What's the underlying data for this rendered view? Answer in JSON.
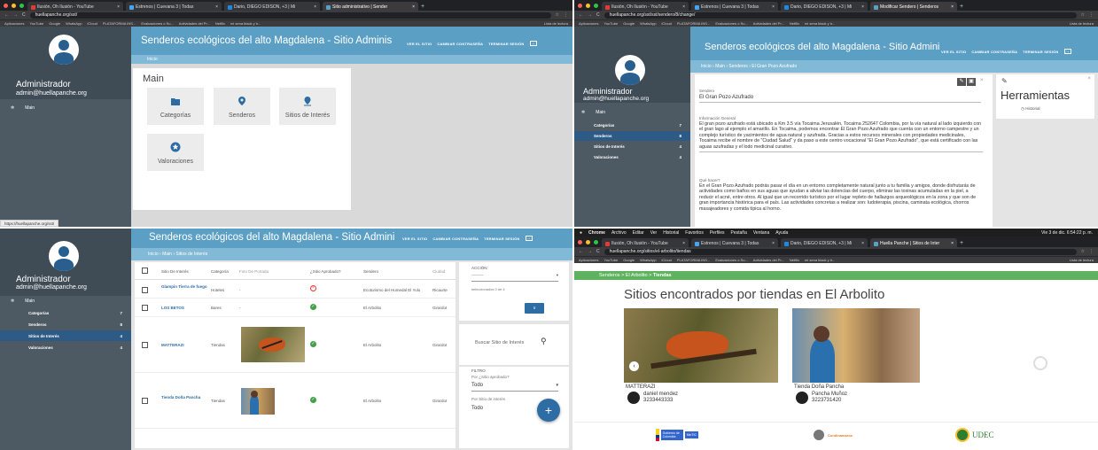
{
  "q1": {
    "tabs": [
      {
        "label": "Ilusión, Oh Ilusión - YouTube",
        "color": "#e53935"
      },
      {
        "label": "Estrenos | Cuevana 3 | Todas",
        "color": "#42a5f5"
      },
      {
        "label": "Dario, DIEGO EDISON, +3 | Mi",
        "color": "#1e88e5"
      },
      {
        "label": "Sitio administrativo | Sender",
        "color": "#5c9fc4",
        "active": true
      }
    ],
    "url": "huellapanche.org/sst/",
    "bookmarks": [
      "Aplicaciones",
      "YouTube",
      "Google",
      "WhatsApp",
      "iCloud",
      "PLATAFORMA INS...",
      "Evaluaciones o Su...",
      "Actividades del Pr...",
      "Netflix",
      "mi sena black y tr..."
    ],
    "bookmarks_right": "Lista de lectura",
    "admin_name": "Administrador",
    "admin_email": "admin@huellapanche.org",
    "menu_main": "Main",
    "title": "Senderos ecológicos del alto Magdalena - Sitio Adminis",
    "links": [
      "VER EL SITIO",
      "CAMBIAR CONTRASEÑA",
      "TERMINAR SESIÓN"
    ],
    "breadcrumb": "Inicio",
    "section": "Main",
    "tiles": [
      "Categorías",
      "Senderos",
      "Sitios de Interés",
      "Valoraciones"
    ],
    "status_url": "https://huellapanche.org/sst/"
  },
  "q2": {
    "tabs": [
      {
        "label": "Ilusión, Oh Ilusión - YouTube",
        "color": "#e53935"
      },
      {
        "label": "Estrenos | Cuevana 3 | Todas",
        "color": "#42a5f5"
      },
      {
        "label": "Dario, DIEGO EDISON, +3 | Mi",
        "color": "#1e88e5"
      },
      {
        "label": "Modificar Sendero | Senderos",
        "color": "#5c9fc4",
        "active": true
      }
    ],
    "url": "huellapanche.org/sst/sst/sendero/8/change/",
    "bookmarks": [
      "Aplicaciones",
      "YouTube",
      "Google",
      "WhatsApp",
      "iCloud",
      "PLATAFORMA INS...",
      "Evaluaciones o Su...",
      "Actividades del Pr...",
      "Netflix",
      "mi sena black y tr..."
    ],
    "bookmarks_right": "Lista de lectura",
    "admin_name": "Administrador",
    "admin_email": "admin@huellapanche.org",
    "menu_main": "Main",
    "nav": [
      {
        "label": "Categorías",
        "count": "7"
      },
      {
        "label": "Senderos",
        "count": "8",
        "active": true
      },
      {
        "label": "Sitios de Interés",
        "count": "4"
      },
      {
        "label": "Valoraciones",
        "count": "4"
      }
    ],
    "title": "Senderos ecológicos del alto Magdalena - Sitio Admini",
    "links": [
      "VER EL SITIO",
      "CAMBIAR CONTRASEÑA",
      "TERMINAR SESIÓN"
    ],
    "breadcrumb": "Inicio › Main › Senderos › El Gran Pozo Azufrado",
    "field_sendero_label": "Sendero",
    "field_sendero_value": "El Gran Pozo Azufrado",
    "info_label": "Información General",
    "info_text": "El gran pozo azufrado está ubicado a Km 3.5 vía Tocaima Jerusalén, Tocaima 252647 Colombia, por la vía natural al lado izquierdo con el gran lago al ejemplo el amarillo. En Tocaima, podemos encontrar El Gran Pozo Azufrado que cuenta con un entorno campestre y un complejo turístico de yacimientos de agua natural y azufrada. Gracias a estos recursos minerales con propiedades medicinales, Tocaima recibe el nombre de \"Ciudad Salud\" y da paso a este centro vocacional \"El Gran Pozo Azufrado\", que está certificado con las aguas azufradas y el lodo medicinal curativo.",
    "what_label": "Qué hacer?",
    "what_text": "En el Gran Pozo Azufrado podrás pasar el día en un entorno completamente natural junto a tu familia y amigos, donde disfrutarás de actividades como baños en sus aguas que ayudan a aliviar las dolencias del cuerpo, eliminar las toxinas acumuladas en la piel, a reducir el acné, entre otros. Al igual que un recorrido turístico por el lugar repleto de hallazgos arqueológicos en la zona y que son de gran importancia histórica para el país. Las actividades concretas a realizar son: ludoterapia, piscina, caminata ecológica, chorros masajeadores y comida típica al horno.",
    "tools_title": "Herramientas",
    "tools_item": "Historial"
  },
  "q3": {
    "admin_name": "Administrador",
    "admin_email": "admin@huellapanche.org",
    "menu_main": "Main",
    "nav": [
      {
        "label": "Categorías",
        "count": "7"
      },
      {
        "label": "Senderos",
        "count": "8"
      },
      {
        "label": "Sitios de Interés",
        "count": "4",
        "active": true
      },
      {
        "label": "Valoraciones",
        "count": "4"
      }
    ],
    "title": "Senderos ecológicos del alto Magdalena - Sitio Admini",
    "links": [
      "VER EL SITIO",
      "CAMBIAR CONTRASEÑA",
      "TERMINAR SESIÓN"
    ],
    "breadcrumb": "Inicio › Main › Sitios de Interés",
    "columns": [
      "Sitio De Interés",
      "Categoría",
      "Foto De Portada",
      "¿Sitio Aprobado?",
      "Sendero",
      "Ciudad"
    ],
    "rows": [
      {
        "name": "Glampin Tierra de fuego",
        "cat": "Hoteles",
        "photo": "-",
        "approved": false,
        "sendero": "Ecoturismo del Humedal El Yulo",
        "ciudad": "Ricaurte"
      },
      {
        "name": "LOS BETOS",
        "cat": "Bares",
        "photo": "-",
        "approved": true,
        "sendero": "El Arbolito",
        "ciudad": "Girardot"
      },
      {
        "name": "MATTERAZI",
        "cat": "Tiendas",
        "photo": "butterfly",
        "approved": true,
        "sendero": "El Arbolito",
        "ciudad": "Girardot"
      },
      {
        "name": "Tienda Doña Pancha",
        "cat": "Tiendas",
        "photo": "store",
        "approved": true,
        "sendero": "El Arbolito",
        "ciudad": "Girardot"
      }
    ],
    "action_label": "ACCIÓN:",
    "action_value": "---------",
    "selected_text": "seleccionados 0 de 4",
    "go_label": "Ir",
    "search_placeholder": "Buscar Sitio de Interés",
    "filter_label": "FILTRO",
    "filter1_label": "Por ¿Sitio aprobado?",
    "filter1_value": "Todo",
    "filter2_label": "Por Sitio de interés",
    "filter2_value": "Todo",
    "fab": "+"
  },
  "q4": {
    "mac_menu": [
      "Chrome",
      "Archivo",
      "Editar",
      "Ver",
      "Historial",
      "Favoritos",
      "Perfiles",
      "Pestaña",
      "Ventana",
      "Ayuda"
    ],
    "mac_right": "Vie 3 de dic. 6:54:22 p. m.",
    "tabs": [
      {
        "label": "Ilusión, Oh Ilusión - YouTube",
        "color": "#e53935"
      },
      {
        "label": "Estrenos | Cuevana 3 | Todas",
        "color": "#42a5f5"
      },
      {
        "label": "Dario, DIEGO EDISON, +3 | Mi",
        "color": "#1e88e5"
      },
      {
        "label": "Huella Panche | Sitios de Inter",
        "color": "#5c9fc4",
        "active": true
      }
    ],
    "url": "huellapanche.org/sitios/el-arbolito/tiendas",
    "bookmarks": [
      "Aplicaciones",
      "YouTube",
      "Google",
      "WhatsApp",
      "iCloud",
      "PLATAFORMA INS...",
      "Evaluaciones o Su...",
      "Actividades del Pr...",
      "Netflix",
      "mi sena black y tr..."
    ],
    "bookmarks_right": "Lista de lectura",
    "crumb": [
      "Senderos",
      "El Arbolito",
      "Tiendas"
    ],
    "heading": "Sitios encontrados por tiendas en El Arbolito",
    "cards": [
      {
        "title": "MATTERAZI",
        "person": "daniel mendez",
        "phone": "3233443333"
      },
      {
        "title": "Tienda Doña Pancha",
        "person": "Pancha Muñoz",
        "phone": "3223731420"
      }
    ],
    "footer_logos": [
      "Gobierno de Colombia",
      "MinTIC",
      "Cundinamarca",
      "UDEC"
    ]
  }
}
